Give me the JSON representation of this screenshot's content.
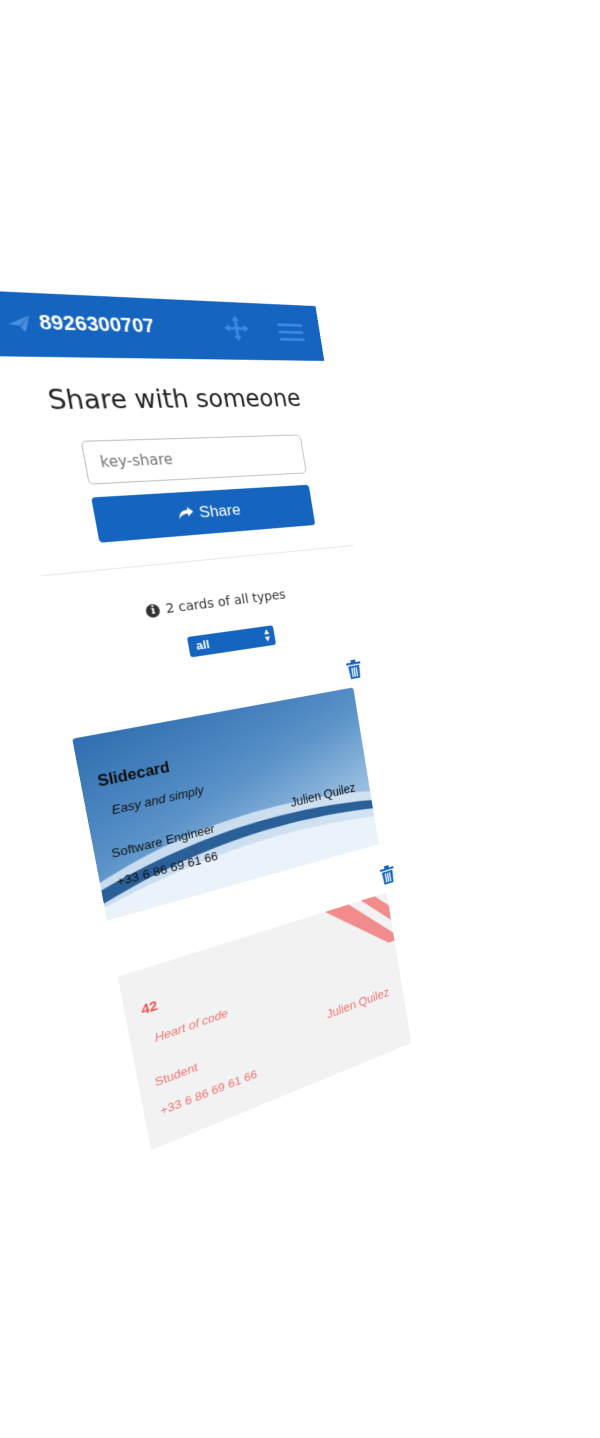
{
  "navbar": {
    "phone_number": "8926300707",
    "brand_icon": "paper-plane-icon",
    "move_icon": "move-arrows-icon",
    "menu_icon": "hamburger-menu-icon",
    "color": "#1565c0"
  },
  "share": {
    "title": "Share with someone",
    "input_placeholder": "key-share",
    "button_label": "Share",
    "button_icon": "share-arrow-icon"
  },
  "filter": {
    "info_text": "2 cards of all types",
    "info_icon": "info-circle-icon",
    "select_value": "all"
  },
  "cards": [
    {
      "title": "Slidecard",
      "subtitle": "Easy and simply",
      "job": "Software Engineer",
      "name": "Julien Quilez",
      "phone": "+33 6 86 69 61 66",
      "delete_icon": "trash-icon",
      "theme_color": "#2f6eb0"
    },
    {
      "title": "42",
      "subtitle": "Heart of code",
      "job": "Student",
      "name": "Julien Quilez",
      "phone": "+33 6 86 69 61 66",
      "delete_icon": "trash-icon",
      "theme_color": "#f06a6a"
    }
  ]
}
